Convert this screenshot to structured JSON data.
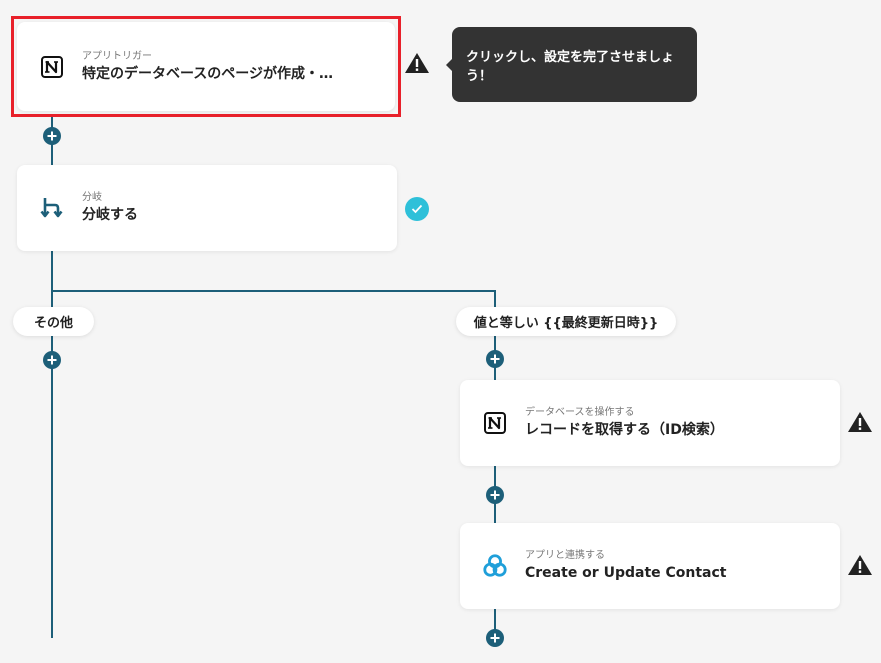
{
  "trigger": {
    "sub": "アプリトリガー",
    "title": "特定のデータベースのページが作成・…",
    "icon": "notion-icon"
  },
  "tooltip": {
    "text": "クリックし、設定を完了させましょう！"
  },
  "branch": {
    "sub": "分岐",
    "title": "分岐する",
    "icon": "branch-icon"
  },
  "branches": {
    "other_label": "その他",
    "match_label": "値と等しい {{最終更新日時}}"
  },
  "record_step": {
    "sub": "データベースを操作する",
    "title": "レコードを取得する（ID検索）",
    "icon": "notion-icon"
  },
  "contact_step": {
    "sub": "アプリと連携する",
    "title": "Create or Update Contact",
    "icon": "app-logo-icon"
  },
  "colors": {
    "line": "#1d5f79",
    "selected_border": "#e8202a",
    "check": "#2ec0d9",
    "tooltip_bg": "#333333"
  }
}
